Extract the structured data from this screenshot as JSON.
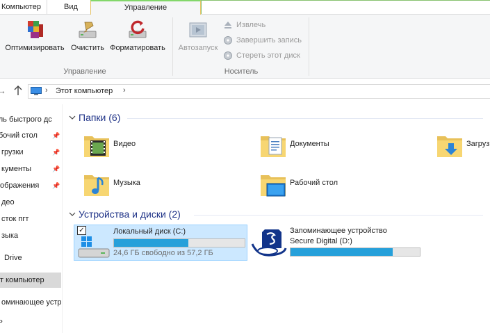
{
  "tabs": {
    "computer": "Компьютер",
    "view": "Вид",
    "manage": "Управление"
  },
  "ribbon": {
    "optimize": "Оптимизировать",
    "cleanup": "Очистить",
    "format": "Форматировать",
    "group_manage": "Управление",
    "autoplay": "Автозапуск",
    "eject": "Извлечь",
    "finish_burn": "Завершить запись",
    "erase_disc": "Стереть этот диск",
    "group_media": "Носитель"
  },
  "address": {
    "crumb": "Этот компьютер"
  },
  "nav": {
    "items": [
      "ель быстрого дс",
      "бочий стол",
      "грузки",
      "кументы",
      "ображения",
      "део",
      "сток пгт",
      "зыка",
      "Drive",
      "т компьютер",
      "оминающее устр",
      "ь"
    ]
  },
  "content": {
    "folders_title": "Папки (6)",
    "folders": [
      "Видео",
      "Документы",
      "Загрузки",
      "Музыка",
      "Рабочий стол"
    ],
    "devices_title": "Устройства и диски (2)",
    "drives": [
      {
        "name": "Локальный диск (C:)",
        "free": "24,6 ГБ свободно из 57,2 ГБ",
        "used_fraction": 0.57
      },
      {
        "name_line1": "Запоминающее устройство",
        "name_line2": "Secure Digital (D:)",
        "used_fraction": 0.79
      }
    ]
  },
  "colors": {
    "accent": "#26a0da",
    "section_title": "#1e3287",
    "selection": "#cce8ff"
  }
}
